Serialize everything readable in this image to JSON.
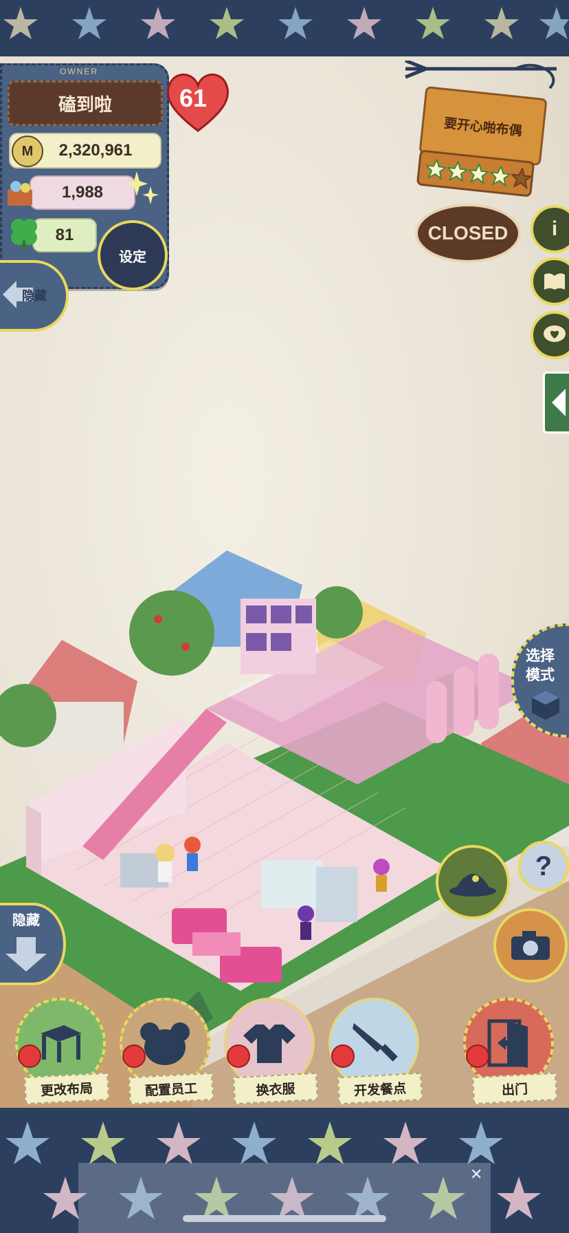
{
  "owner": {
    "owner_label": "OWNER",
    "name": "磕到啦",
    "level": "61",
    "money": "2,320,961",
    "ingredients": "1,988",
    "clovers": "81"
  },
  "buttons": {
    "settings": "设定",
    "hide_top": "隐藏",
    "hide_bottom": "隐藏",
    "select_mode": "选择模式",
    "help": "?"
  },
  "shop": {
    "name": "要开心啪布偶",
    "rating": 4,
    "rating_max": 5,
    "status": "CLOSED"
  },
  "side_menu": [
    {
      "icon": "info-icon",
      "label": "i"
    },
    {
      "icon": "book-icon"
    },
    {
      "icon": "heart-chat-icon"
    }
  ],
  "bottom_menu": [
    {
      "name": "layout",
      "label": "更改布局",
      "color": "#7fb86a"
    },
    {
      "name": "staff",
      "label": "配置员工",
      "color": "#c9a67a"
    },
    {
      "name": "clothes",
      "label": "换衣服",
      "color": "#e7c3cc"
    },
    {
      "name": "recipes",
      "label": "开发餐点",
      "color": "#bfd6e6"
    },
    {
      "name": "go_out",
      "label": "出门",
      "color": "#d76a5a"
    }
  ],
  "colors": {
    "panel_blue": "#4a6283",
    "accent_yellow": "#e8d860",
    "sign_orange": "#d7933b"
  }
}
